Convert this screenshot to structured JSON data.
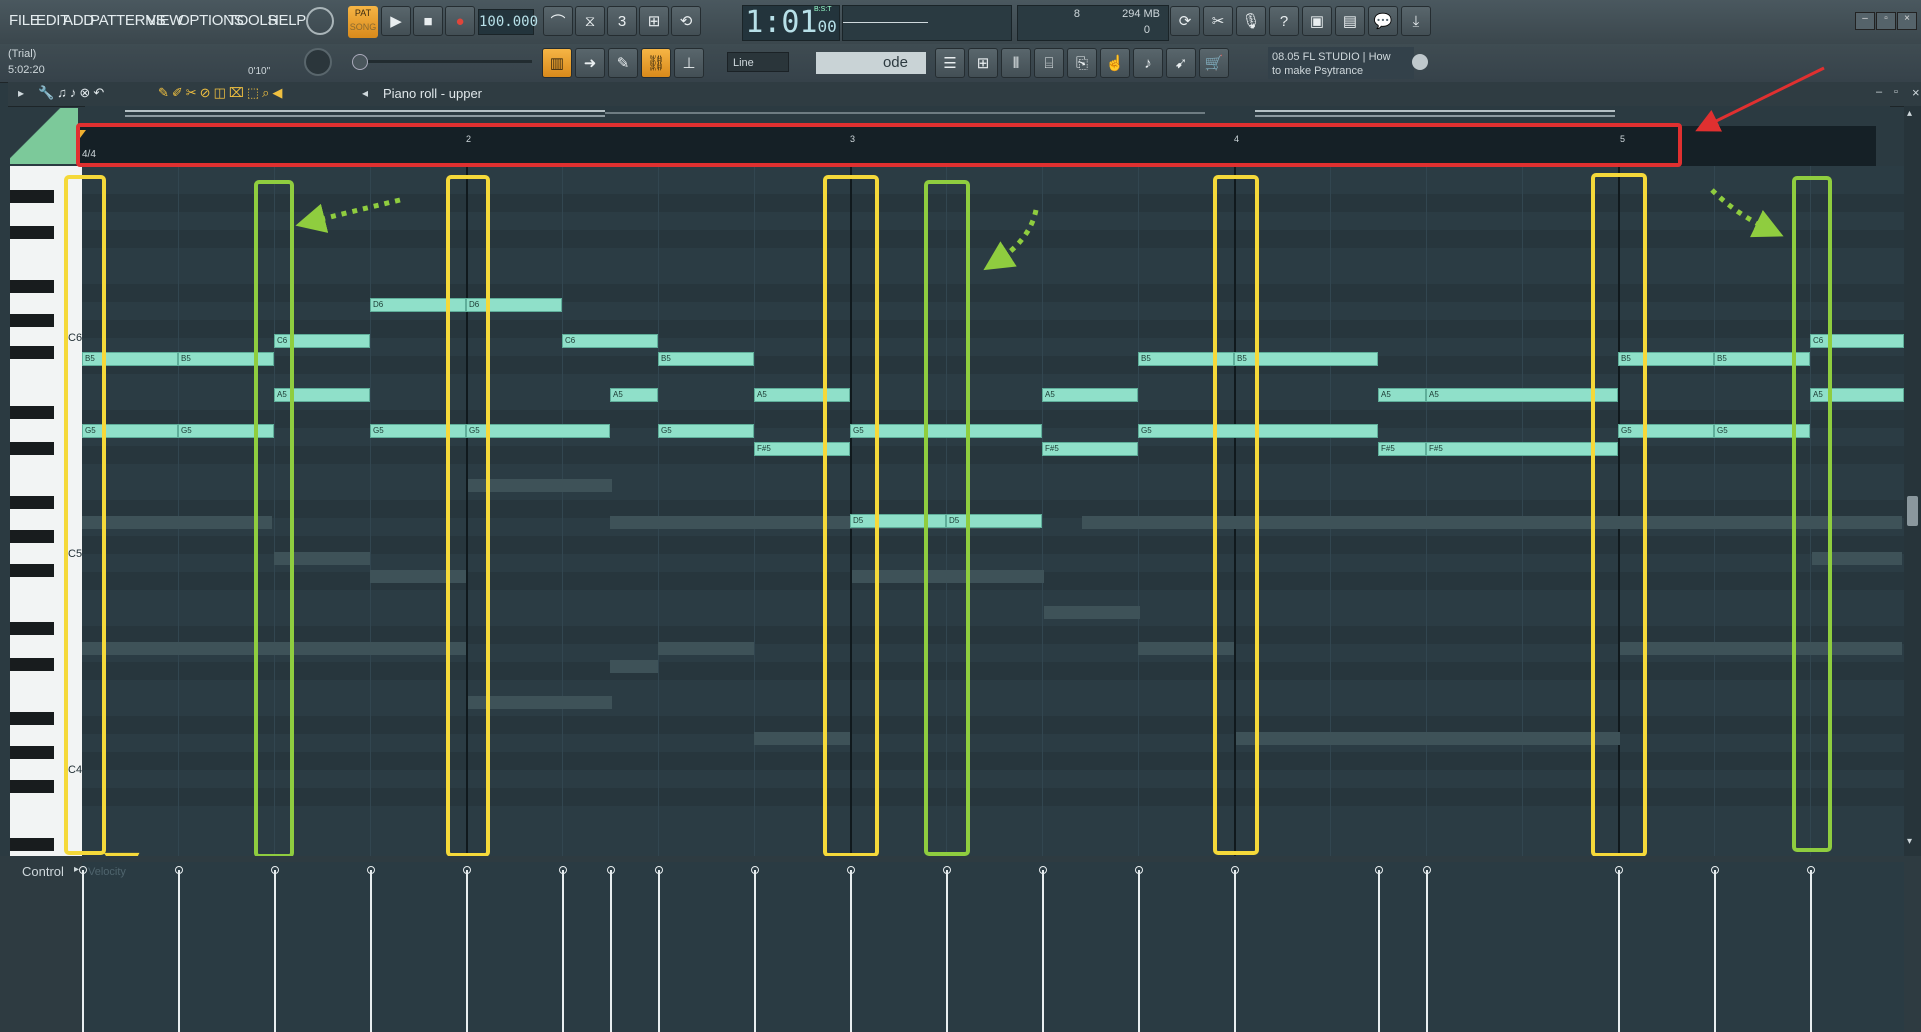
{
  "menu": [
    "FILE",
    "EDIT",
    "ADD",
    "PATTERNS",
    "VIEW",
    "OPTIONS",
    "TOOLS",
    "HELP"
  ],
  "transport": {
    "pat": "PAT",
    "song": "SONG",
    "tempo": "100.000",
    "time": "1:01",
    "time_sub": "00",
    "bst": "B:S:T",
    "cpu": "8",
    "mem": "294 MB",
    "mem_sub": "0"
  },
  "project": {
    "trial": "(Trial)",
    "time": "5:02:20",
    "elapsed": "0'10\""
  },
  "tools": {
    "snap": "Line",
    "pattern": "ode",
    "hint_line1": "08.05  FL STUDIO | How",
    "hint_line2": "to make Psytrance"
  },
  "pianoroll": {
    "title": "Piano roll - upper",
    "timesig": "4/4",
    "bars": [
      "2",
      "3",
      "4",
      "5"
    ],
    "control": "Control",
    "control_value": "Velocity"
  },
  "keys": {
    "c6": "C6",
    "c5": "C5",
    "c4": "C4"
  },
  "notes": [
    "B5",
    "B5",
    "C6",
    "A5",
    "G5",
    "G5",
    "D6",
    "D6",
    "C6",
    "B5",
    "A5",
    "G5",
    "A5",
    "F#5",
    "G5",
    "G5",
    "D5",
    "D5",
    "A5",
    "F#5",
    "B5",
    "B5",
    "G5",
    "G5",
    "A5",
    "A5",
    "F#5",
    "F#5",
    "B5",
    "B5",
    "G5",
    "G5",
    "C6",
    "A5"
  ],
  "colors": {
    "note": "#8fe0c9",
    "yellow_box": "#f5d93a",
    "green_box": "#8fcd3f",
    "red_box": "#e03030",
    "accent": "#f6b545"
  }
}
